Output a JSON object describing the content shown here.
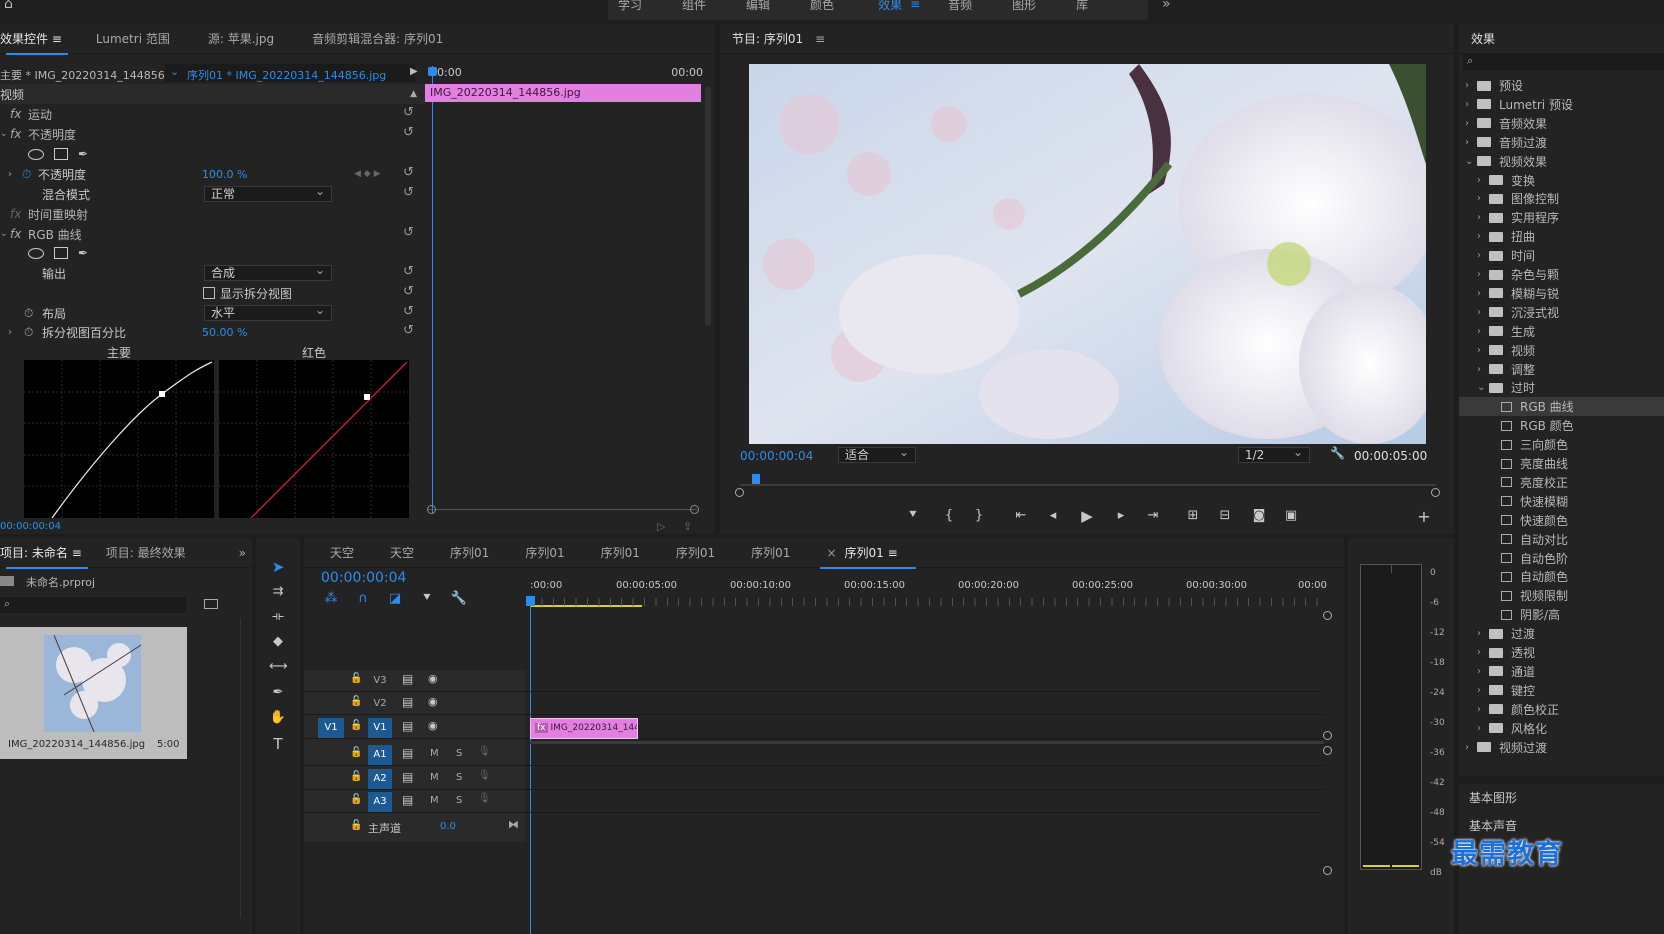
{
  "top_nav": {
    "items": [
      "学习",
      "组件",
      "编辑",
      "颜色",
      "效果",
      "音频",
      "图形",
      "库"
    ],
    "active_index": 4,
    "more": "»"
  },
  "effect_controls": {
    "tabs": [
      "效果控件",
      "Lumetri 范围",
      "源: 苹果.jpg",
      "音频剪辑混合器: 序列01"
    ],
    "active_tab": 0,
    "master_clip": "主要 * IMG_20220314_144856.jpg",
    "sequence_clip": "序列01 * IMG_20220314_144856.jpg",
    "time_start": "00:00",
    "time_end": "00:00",
    "clip_bar_label": "IMG_20220314_144856.jpg",
    "section_video": "视频",
    "motion": "运动",
    "opacity_group": "不透明度",
    "opacity_label": "不透明度",
    "opacity_value": "100.0 %",
    "blend_label": "混合模式",
    "blend_value": "正常",
    "time_remap": "时间重映射",
    "rgb_curves": "RGB 曲线",
    "output_label": "输出",
    "output_value": "合成",
    "split_view_label": "显示拆分视图",
    "layout_label": "布局",
    "layout_value": "水平",
    "split_percent_label": "拆分视图百分比",
    "split_percent_value": "50.00 %",
    "curve_master_label": "主要",
    "curve_red_label": "红色",
    "current_time": "00:00:00:04"
  },
  "program_monitor": {
    "title": "节目: 序列01",
    "current_time": "00:00:00:04",
    "fit_value": "适合",
    "resolution": "1/2",
    "duration": "00:00:05:00"
  },
  "effects_panel": {
    "title": "效果",
    "search_placeholder": "",
    "top_items": [
      "预设",
      "Lumetri 预设",
      "音频效果",
      "音频过渡",
      "视频效果"
    ],
    "video_effects": [
      "变换",
      "图像控制",
      "实用程序",
      "扭曲",
      "时间",
      "杂色与颗",
      "模糊与锐",
      "沉浸式视",
      "生成",
      "视频",
      "调整",
      "过时"
    ],
    "obsolete_items": [
      "RGB 曲线",
      "RGB 颜色",
      "三向颜色",
      "亮度曲线",
      "亮度校正",
      "快速模糊",
      "快速颜色",
      "自动对比",
      "自动色阶",
      "自动颜色",
      "视频限制",
      "阴影/高"
    ],
    "more_video_effects": [
      "过渡",
      "透视",
      "通道",
      "键控",
      "颜色校正",
      "风格化"
    ],
    "last_item": "视频过渡",
    "bottom_items": [
      "基本图形",
      "基本声音"
    ]
  },
  "project_panel": {
    "tabs": [
      "项目: 未命名",
      "项目: 最终效果"
    ],
    "more": "»",
    "project_file": "未命名.prproj",
    "thumb_name": "IMG_20220314_144856.jpg",
    "thumb_duration": "5:00"
  },
  "timeline": {
    "tabs": [
      "天空",
      "天空",
      "序列01",
      "序列01",
      "序列01",
      "序列01",
      "序列01",
      "序列01"
    ],
    "active_tab": 7,
    "close_glyph": "×",
    "timecode": "00:00:00:04",
    "ruler": [
      ":00:00",
      "00:00:05:00",
      "00:00:10:00",
      "00:00:15:00",
      "00:00:20:00",
      "00:00:25:00",
      "00:00:30:00",
      "00:00"
    ],
    "video_tracks": [
      "V3",
      "V2",
      "V1"
    ],
    "audio_tracks": [
      "A1",
      "A2",
      "A3"
    ],
    "source_patch": "V1",
    "mute": "M",
    "solo": "S",
    "master_label": "主声道",
    "master_value": "0.0",
    "clip_label": "IMG_20220314_144",
    "clip_fx": "fx"
  },
  "audio_meter": {
    "scale": [
      "0",
      "-6",
      "-12",
      "-18",
      "-24",
      "-30",
      "-36",
      "-42",
      "-48",
      "-54",
      "dB"
    ]
  },
  "watermark": "最需教育",
  "colors": {
    "accent": "#2d8ceb",
    "clip_pink": "#e27fe0",
    "panel": "#232323",
    "bg": "#1d1d1d"
  }
}
